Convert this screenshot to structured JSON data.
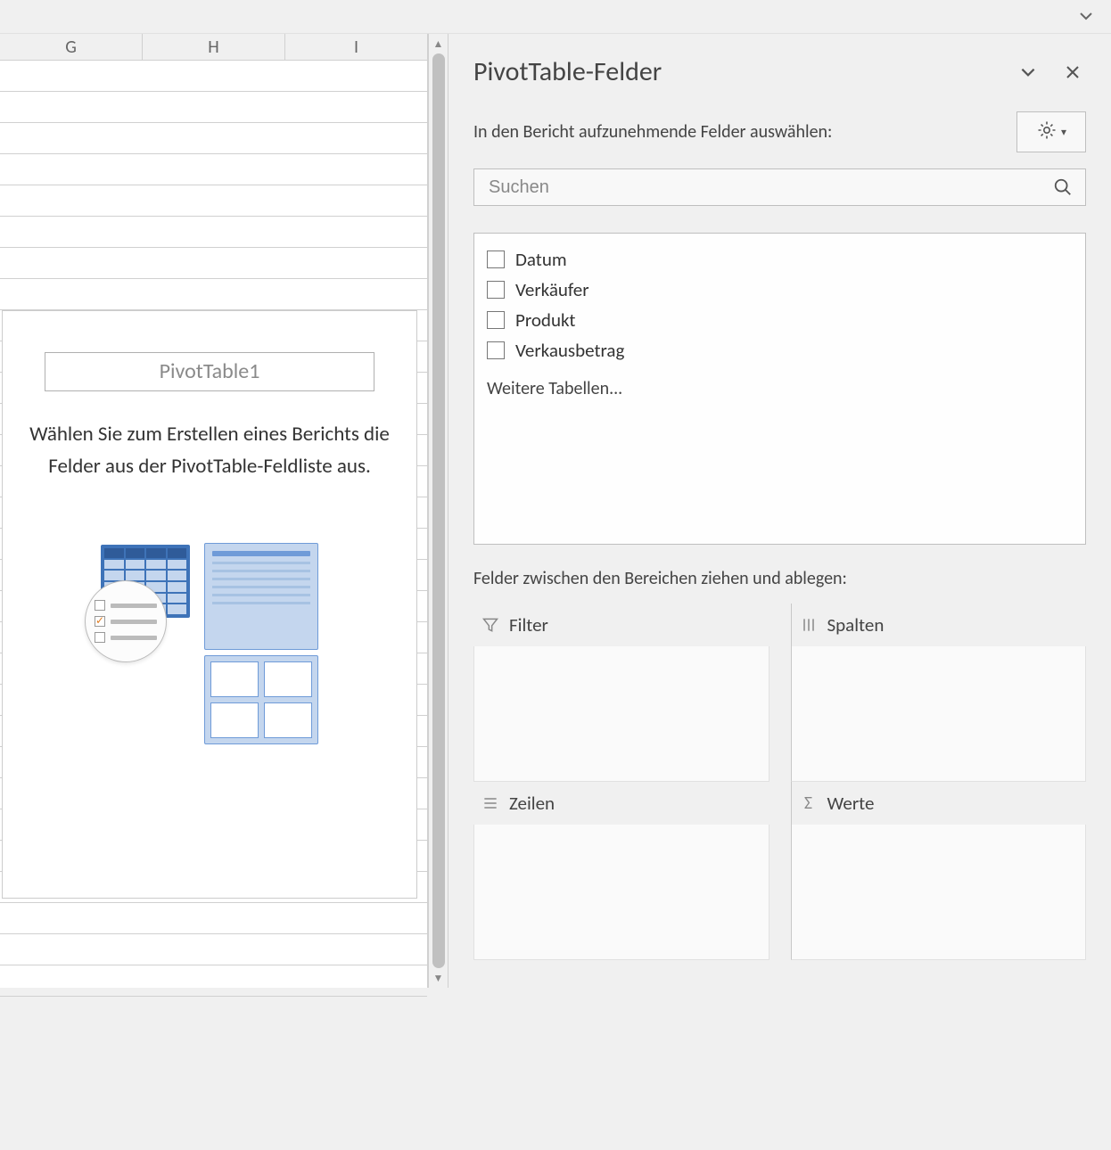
{
  "columns": [
    "G",
    "H",
    "I"
  ],
  "pivot_card": {
    "title": "PivotTable1",
    "instruction": "Wählen Sie zum Erstellen eines Berichts die Felder aus der PivotTable-Feldliste aus."
  },
  "pane": {
    "title": "PivotTable-Felder",
    "subtitle": "In den Bericht aufzunehmende Felder auswählen:",
    "search_placeholder": "Suchen",
    "fields": [
      "Datum",
      "Verkäufer",
      "Produkt",
      "Verkausbetrag"
    ],
    "more_tables": "Weitere Tabellen...",
    "drag_hint": "Felder zwischen den Bereichen ziehen und ablegen:",
    "zones": {
      "filter": "Filter",
      "columns": "Spalten",
      "rows": "Zeilen",
      "values": "Werte"
    }
  }
}
